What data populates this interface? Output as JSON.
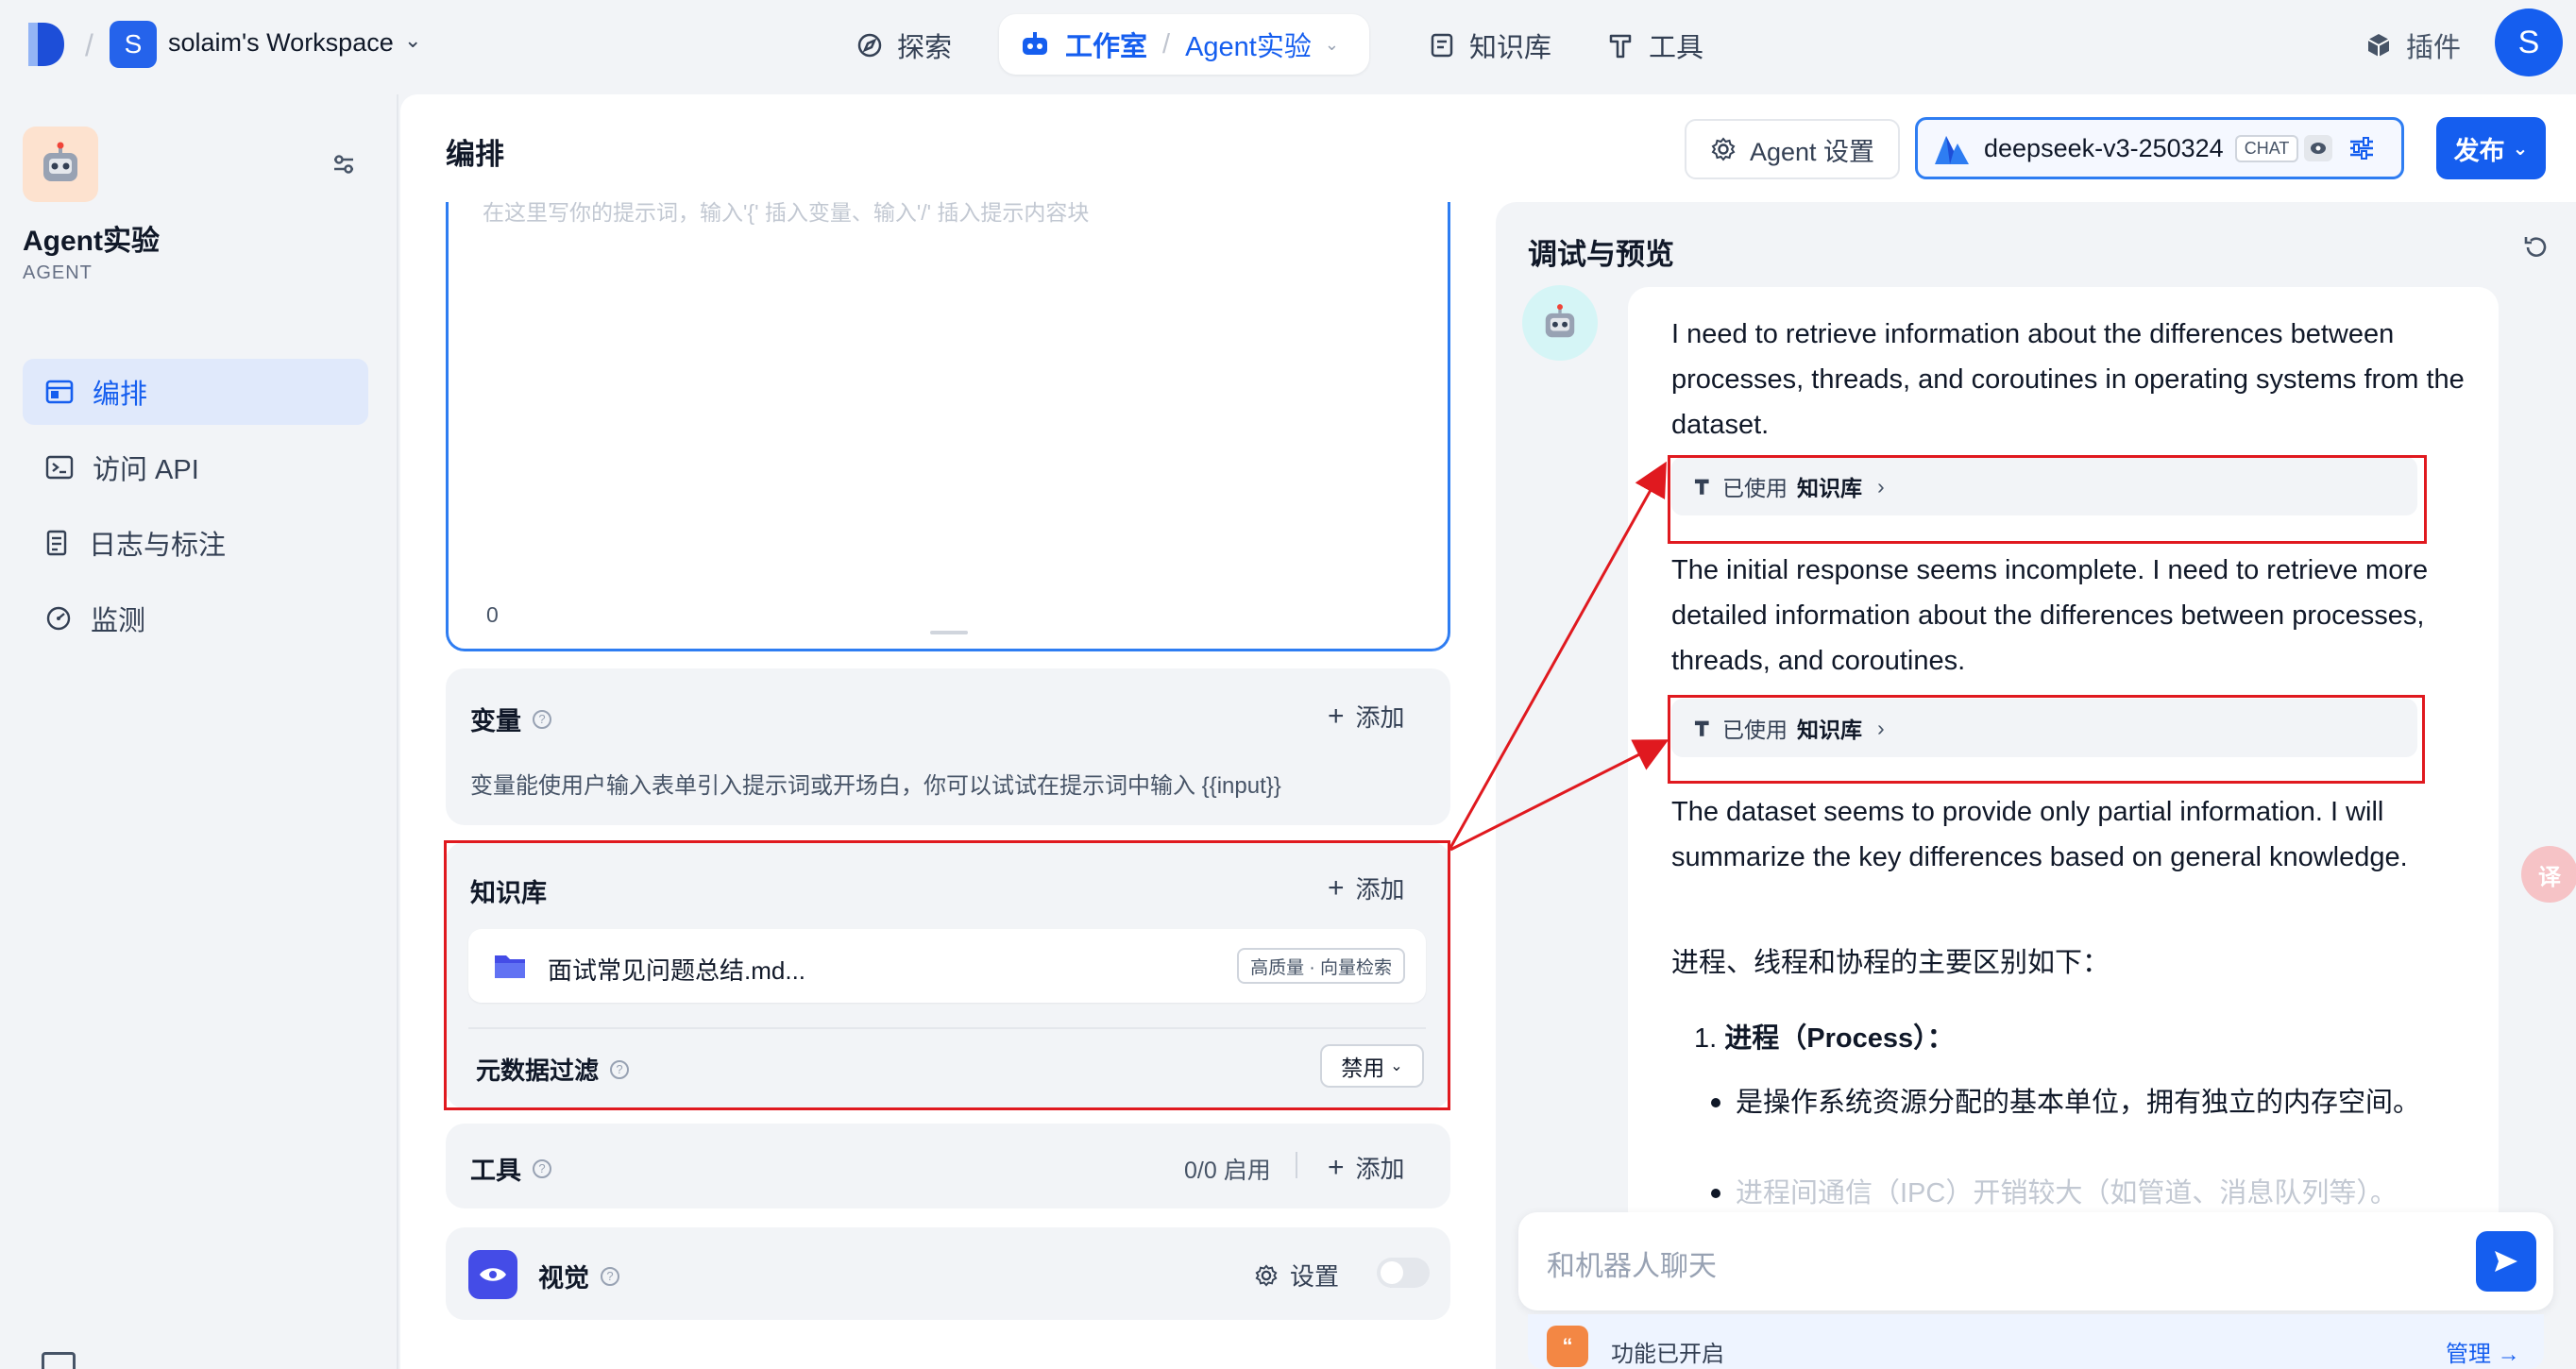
{
  "workspace": {
    "avatar_letter": "S",
    "name": "solaim's Workspace"
  },
  "nav": {
    "explore": "探索",
    "studio": "工作室",
    "current_app": "Agent实验",
    "knowledge": "知识库",
    "tools": "工具",
    "plugins": "插件"
  },
  "user": {
    "avatar_letter": "S"
  },
  "app": {
    "name": "Agent实验",
    "type": "AGENT"
  },
  "sidebar": {
    "items": [
      {
        "label": "编排",
        "active": true,
        "icon": "layout-icon"
      },
      {
        "label": "访问 API",
        "active": false,
        "icon": "terminal-icon"
      },
      {
        "label": "日志与标注",
        "active": false,
        "icon": "log-icon"
      },
      {
        "label": "监测",
        "active": false,
        "icon": "gauge-icon"
      }
    ]
  },
  "main": {
    "title": "编排",
    "prompt": {
      "placeholder": "在这里写你的提示词，输入'{' 插入变量、输入'/' 插入提示内容块",
      "count": "0"
    },
    "variables": {
      "title": "变量",
      "add": "添加",
      "description": "变量能使用户输入表单引入提示词或开场白，你可以试试在提示词中输入 {{input}}"
    },
    "knowledge": {
      "title": "知识库",
      "add": "添加",
      "file_name": "面试常见问题总结.md...",
      "file_badge": "高质量 · 向量检索",
      "metadata_filter_label": "元数据过滤",
      "metadata_filter_value": "禁用"
    },
    "tools": {
      "title": "工具",
      "count": "0/0 启用",
      "add": "添加"
    },
    "vision": {
      "title": "视觉",
      "settings": "设置",
      "enabled": false
    }
  },
  "header": {
    "agent_settings": "Agent 设置",
    "model_name": "deepseek-v3-250324",
    "model_tag": "CHAT",
    "publish": "发布"
  },
  "debug": {
    "title": "调试与预览",
    "messages": {
      "p1": "I need to retrieve information about the differences between processes, threads, and coroutines in operating systems from the dataset.",
      "kb_used_1_prefix": "已使用",
      "kb_used_1_name": "知识库",
      "p2": "The initial response seems incomplete. I need to retrieve more detailed information about the differences between processes, threads, and coroutines.",
      "kb_used_2_prefix": "已使用",
      "kb_used_2_name": "知识库",
      "p3": "The dataset seems to provide only partial information. I will summarize the key differences based on general knowledge.",
      "p4": "进程、线程和协程的主要区别如下：",
      "list_1_num": "1.",
      "list_1_title": "进程（Process）：",
      "bullet_1": "是操作系统资源分配的基本单位，拥有独立的内存空间。",
      "bullet_2": "进程间通信（IPC）开销较大（如管道、消息队列等）。"
    },
    "input_placeholder": "和机器人聊天",
    "feature_status": "功能已开启",
    "manage": "管理"
  },
  "colors": {
    "accent": "#155eef",
    "highlight_red": "#e0191f",
    "agent_icon_bg": "#fde2cf"
  }
}
